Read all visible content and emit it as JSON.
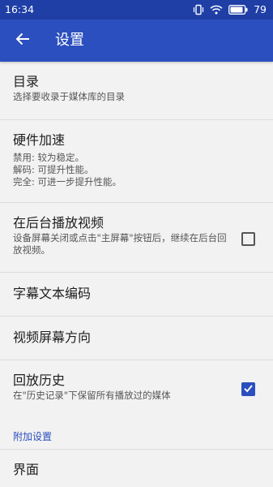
{
  "status_bar": {
    "time": "16:34",
    "battery": "79",
    "icons": [
      "vibrate-icon",
      "wifi-icon",
      "battery-icon"
    ]
  },
  "app_bar": {
    "back_icon": "arrow-left-icon",
    "title": "设置"
  },
  "settings": {
    "directory": {
      "title": "目录",
      "summary": "选择要收录于媒体库的目录"
    },
    "hardware_acceleration": {
      "title": "硬件加速",
      "summary_lines": [
        "禁用: 较为稳定。",
        "解码: 可提升性能。",
        "完全: 可进一步提升性能。"
      ]
    },
    "background_playback": {
      "title": "在后台播放视频",
      "summary": "设备屏幕关闭或点击\"主屏幕\"按钮后，继续在后台回放视频。",
      "checked": false
    },
    "subtitle_encoding": {
      "title": "字幕文本编码"
    },
    "screen_orientation": {
      "title": "视频屏幕方向"
    },
    "playback_history": {
      "title": "回放历史",
      "summary": "在\"历史记录\"下保留所有播放过的媒体",
      "checked": true
    }
  },
  "extra_section": {
    "header": "附加设置",
    "interface_title": "界面"
  },
  "colors": {
    "primary": "#2b4fbe",
    "status_bar": "#1f3fa6",
    "background": "#f2f2f2"
  }
}
